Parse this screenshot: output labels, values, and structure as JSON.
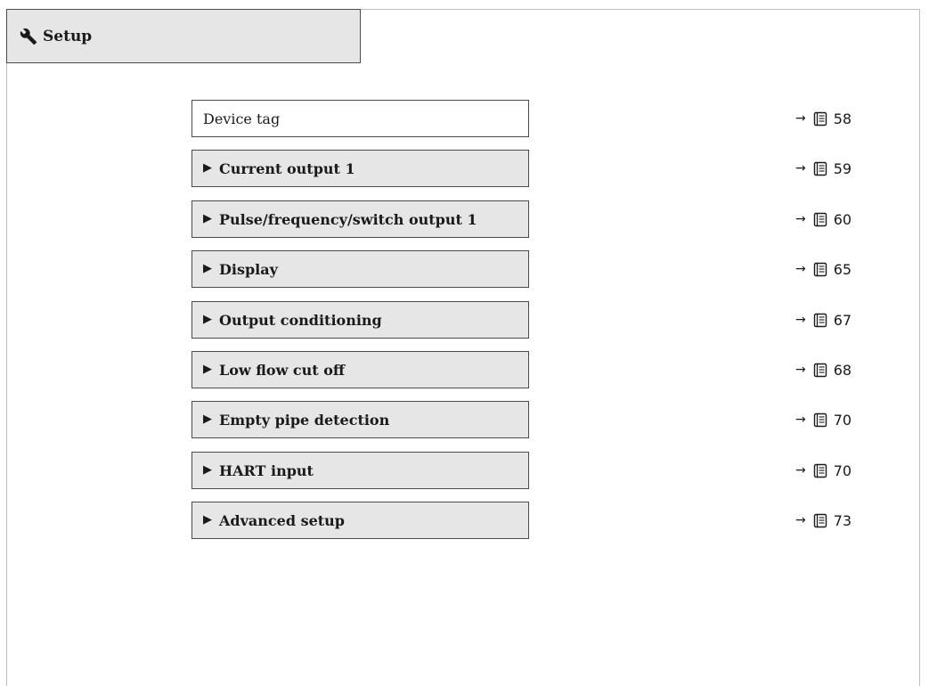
{
  "section": {
    "title": "Setup",
    "icon": "wrench-icon"
  },
  "rows": [
    {
      "label": "Device tag",
      "kind": "parameter",
      "arrow": "→",
      "page": "58"
    },
    {
      "label": "Current output 1",
      "kind": "submenu",
      "marker": "▶",
      "arrow": "→",
      "page": "59"
    },
    {
      "label": "Pulse/frequency/switch output 1",
      "kind": "submenu",
      "marker": "▶",
      "arrow": "→",
      "page": "60"
    },
    {
      "label": "Display",
      "kind": "submenu",
      "marker": "▶",
      "arrow": "→",
      "page": "65"
    },
    {
      "label": "Output conditioning",
      "kind": "submenu",
      "marker": "▶",
      "arrow": "→",
      "page": "67"
    },
    {
      "label": "Low flow cut off",
      "kind": "submenu",
      "marker": "▶",
      "arrow": "→",
      "page": "68"
    },
    {
      "label": "Empty pipe detection",
      "kind": "submenu",
      "marker": "▶",
      "arrow": "→",
      "page": "70"
    },
    {
      "label": "HART input",
      "kind": "submenu",
      "marker": "▶",
      "arrow": "→",
      "page": "70"
    },
    {
      "label": "Advanced setup",
      "kind": "submenu",
      "marker": "▶",
      "arrow": "→",
      "page": "73"
    }
  ]
}
